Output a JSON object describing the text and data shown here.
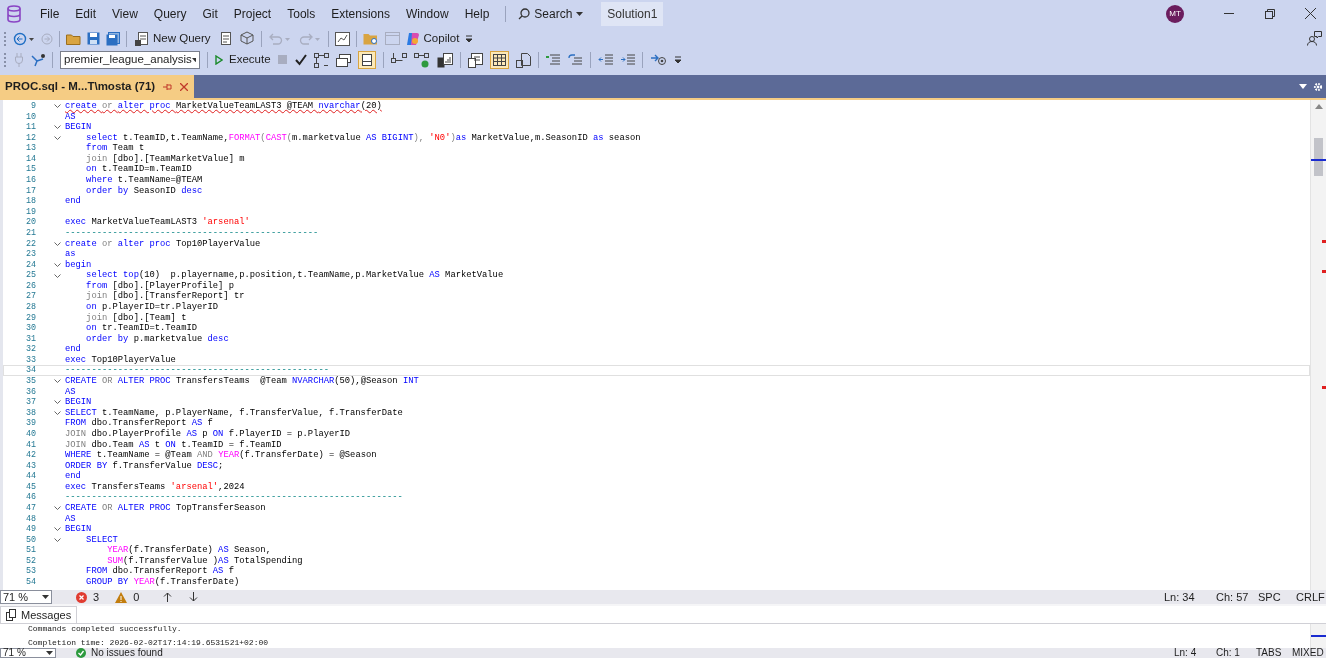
{
  "menu": [
    "File",
    "Edit",
    "View",
    "Query",
    "Git",
    "Project",
    "Tools",
    "Extensions",
    "Window",
    "Help"
  ],
  "search": {
    "label": "Search"
  },
  "solution": "Solution1",
  "avatar": "MT",
  "toolbar": {
    "new_query": "New Query",
    "copilot": "Copilot",
    "database": "premier_league_analysis",
    "execute": "Execute"
  },
  "tab": {
    "title": "PROC.sql - M...T\\mosta (71)",
    "selected": true
  },
  "editor": {
    "lines": [
      {
        "number": "9",
        "fold": true,
        "current": false,
        "error": true,
        "tokens": [
          {
            "kind": "kw",
            "text": "create "
          },
          {
            "kind": "op",
            "text": "or "
          },
          {
            "kind": "kw",
            "text": "alter proc "
          },
          {
            "kind": "id",
            "text": "MarketValueTeamLAST3 @TEAM "
          },
          {
            "kind": "kw",
            "text": "nvarchar"
          },
          {
            "kind": "id",
            "text": "(20)"
          }
        ]
      },
      {
        "number": "10",
        "fold": false,
        "current": false,
        "error": false,
        "tokens": [
          {
            "kind": "kw",
            "text": "AS"
          }
        ]
      },
      {
        "number": "11",
        "fold": true,
        "current": false,
        "error": false,
        "tokens": [
          {
            "kind": "kw",
            "text": "BEGIN"
          }
        ]
      },
      {
        "number": "12",
        "fold": true,
        "current": false,
        "error": false,
        "tokens": [
          {
            "kind": "kw",
            "text": "    select "
          },
          {
            "kind": "id",
            "text": "t.TeamID,t.TeamName,"
          },
          {
            "kind": "fn",
            "text": "FORMAT"
          },
          {
            "kind": "op",
            "text": "("
          },
          {
            "kind": "fn",
            "text": "CAST"
          },
          {
            "kind": "op",
            "text": "("
          },
          {
            "kind": "id",
            "text": "m.marketvalue "
          },
          {
            "kind": "kw",
            "text": "AS BIGINT"
          },
          {
            "kind": "op",
            "text": "), "
          },
          {
            "kind": "str",
            "text": "'N0'"
          },
          {
            "kind": "op",
            "text": ")"
          },
          {
            "kind": "kw",
            "text": "as "
          },
          {
            "kind": "id",
            "text": "MarketValue,m.SeasonID "
          },
          {
            "kind": "kw",
            "text": "as "
          },
          {
            "kind": "id",
            "text": "season"
          }
        ]
      },
      {
        "number": "13",
        "fold": false,
        "current": false,
        "error": false,
        "tokens": [
          {
            "kind": "kw",
            "text": "    from "
          },
          {
            "kind": "id",
            "text": "Team t"
          }
        ]
      },
      {
        "number": "14",
        "fold": false,
        "current": false,
        "error": false,
        "tokens": [
          {
            "kind": "op",
            "text": "    join "
          },
          {
            "kind": "id",
            "text": "[dbo].[TeamMarketValue] m"
          }
        ]
      },
      {
        "number": "15",
        "fold": false,
        "current": false,
        "error": false,
        "tokens": [
          {
            "kind": "kw",
            "text": "    on "
          },
          {
            "kind": "id",
            "text": "t.TeamID=m.TeamID"
          }
        ]
      },
      {
        "number": "16",
        "fold": false,
        "current": false,
        "error": false,
        "tokens": [
          {
            "kind": "kw",
            "text": "    where "
          },
          {
            "kind": "id",
            "text": "t.TeamName=@TEAM"
          }
        ]
      },
      {
        "number": "17",
        "fold": false,
        "current": false,
        "error": false,
        "tokens": [
          {
            "kind": "kw",
            "text": "    order by "
          },
          {
            "kind": "id",
            "text": "SeasonID "
          },
          {
            "kind": "kw",
            "text": "desc"
          }
        ]
      },
      {
        "number": "18",
        "fold": false,
        "current": false,
        "error": false,
        "tokens": [
          {
            "kind": "kw",
            "text": "end"
          }
        ]
      },
      {
        "number": "19",
        "fold": false,
        "current": false,
        "error": false
      },
      {
        "number": "20",
        "fold": false,
        "current": false,
        "error": false,
        "tokens": [
          {
            "kind": "kw",
            "text": "exec "
          },
          {
            "kind": "id",
            "text": "MarketValueTeamLAST3 "
          },
          {
            "kind": "str",
            "text": "'arsenal'"
          }
        ]
      },
      {
        "number": "21",
        "fold": false,
        "current": false,
        "error": false,
        "tokens": [
          {
            "kind": "cmt",
            "text": "------------------------------------------------"
          }
        ]
      },
      {
        "number": "22",
        "fold": true,
        "current": false,
        "error": false,
        "tokens": [
          {
            "kind": "kw",
            "text": "create "
          },
          {
            "kind": "op",
            "text": "or "
          },
          {
            "kind": "kw",
            "text": "alter proc "
          },
          {
            "kind": "id",
            "text": "Top10PlayerValue"
          }
        ]
      },
      {
        "number": "23",
        "fold": false,
        "current": false,
        "error": false,
        "tokens": [
          {
            "kind": "kw",
            "text": "as"
          }
        ]
      },
      {
        "number": "24",
        "fold": true,
        "current": false,
        "error": false,
        "tokens": [
          {
            "kind": "kw",
            "text": "begin"
          }
        ]
      },
      {
        "number": "25",
        "fold": true,
        "current": false,
        "error": false,
        "tokens": [
          {
            "kind": "kw",
            "text": "    select top"
          },
          {
            "kind": "id",
            "text": "(10)  p.playername,p.position,t.TeamName,p.MarketValue "
          },
          {
            "kind": "kw",
            "text": "AS "
          },
          {
            "kind": "id",
            "text": "MarketValue"
          }
        ]
      },
      {
        "number": "26",
        "fold": false,
        "current": false,
        "error": false,
        "tokens": [
          {
            "kind": "kw",
            "text": "    from "
          },
          {
            "kind": "id",
            "text": "[dbo].[PlayerProfile] p"
          }
        ]
      },
      {
        "number": "27",
        "fold": false,
        "current": false,
        "error": false,
        "tokens": [
          {
            "kind": "op",
            "text": "    join "
          },
          {
            "kind": "id",
            "text": "[dbo].[TransferReport] tr"
          }
        ]
      },
      {
        "number": "28",
        "fold": false,
        "current": false,
        "error": false,
        "tokens": [
          {
            "kind": "kw",
            "text": "    on "
          },
          {
            "kind": "id",
            "text": "p.PlayerID=tr.PlayerID"
          }
        ]
      },
      {
        "number": "29",
        "fold": false,
        "current": false,
        "error": false,
        "tokens": [
          {
            "kind": "op",
            "text": "    join "
          },
          {
            "kind": "id",
            "text": "[dbo].[Team] t"
          }
        ]
      },
      {
        "number": "30",
        "fold": false,
        "current": false,
        "error": false,
        "tokens": [
          {
            "kind": "kw",
            "text": "    on "
          },
          {
            "kind": "id",
            "text": "tr.TeamID=t.TeamID"
          }
        ]
      },
      {
        "number": "31",
        "fold": false,
        "current": false,
        "error": false,
        "tokens": [
          {
            "kind": "kw",
            "text": "    order by "
          },
          {
            "kind": "id",
            "text": "p.marketvalue "
          },
          {
            "kind": "kw",
            "text": "desc"
          }
        ]
      },
      {
        "number": "32",
        "fold": false,
        "current": false,
        "error": false,
        "tokens": [
          {
            "kind": "kw",
            "text": "end"
          }
        ]
      },
      {
        "number": "33",
        "fold": false,
        "current": false,
        "error": false,
        "tokens": [
          {
            "kind": "kw",
            "text": "exec "
          },
          {
            "kind": "id",
            "text": "Top10PlayerValue"
          }
        ]
      },
      {
        "number": "34",
        "fold": false,
        "current": true,
        "error": false,
        "tokens": [
          {
            "kind": "cmt",
            "text": "--------------------------------------------------"
          }
        ]
      },
      {
        "number": "35",
        "fold": true,
        "current": false,
        "error": false,
        "tokens": [
          {
            "kind": "kw",
            "text": "CREATE "
          },
          {
            "kind": "op",
            "text": "OR "
          },
          {
            "kind": "kw",
            "text": "ALTER PROC "
          },
          {
            "kind": "id",
            "text": "TransfersTeams  @Team "
          },
          {
            "kind": "kw",
            "text": "NVARCHAR"
          },
          {
            "kind": "id",
            "text": "(50),@Season "
          },
          {
            "kind": "kw",
            "text": "INT"
          }
        ]
      },
      {
        "number": "36",
        "fold": false,
        "current": false,
        "error": false,
        "tokens": [
          {
            "kind": "kw",
            "text": "AS"
          }
        ]
      },
      {
        "number": "37",
        "fold": true,
        "current": false,
        "error": false,
        "tokens": [
          {
            "kind": "kw",
            "text": "BEGIN"
          }
        ]
      },
      {
        "number": "38",
        "fold": true,
        "current": false,
        "error": false,
        "tokens": [
          {
            "kind": "kw",
            "text": "SELECT "
          },
          {
            "kind": "id",
            "text": "t.TeamName, p.PlayerName, f.TransferValue, f.TransferDate"
          }
        ]
      },
      {
        "number": "39",
        "fold": false,
        "current": false,
        "error": false,
        "tokens": [
          {
            "kind": "kw",
            "text": "FROM "
          },
          {
            "kind": "id",
            "text": "dbo.TransferReport "
          },
          {
            "kind": "kw",
            "text": "AS "
          },
          {
            "kind": "id",
            "text": "f"
          }
        ]
      },
      {
        "number": "40",
        "fold": false,
        "current": false,
        "error": false,
        "tokens": [
          {
            "kind": "op",
            "text": "JOIN "
          },
          {
            "kind": "id",
            "text": "dbo.PlayerProfile "
          },
          {
            "kind": "kw",
            "text": "AS "
          },
          {
            "kind": "id",
            "text": "p "
          },
          {
            "kind": "kw",
            "text": "ON "
          },
          {
            "kind": "id",
            "text": "f.PlayerID = p.PlayerID"
          }
        ]
      },
      {
        "number": "41",
        "fold": false,
        "current": false,
        "error": false,
        "tokens": [
          {
            "kind": "op",
            "text": "JOIN "
          },
          {
            "kind": "id",
            "text": "dbo.Team "
          },
          {
            "kind": "kw",
            "text": "AS "
          },
          {
            "kind": "id",
            "text": "t "
          },
          {
            "kind": "kw",
            "text": "ON "
          },
          {
            "kind": "id",
            "text": "t.TeamID = f.TeamID"
          }
        ]
      },
      {
        "number": "42",
        "fold": false,
        "current": false,
        "error": false,
        "tokens": [
          {
            "kind": "kw",
            "text": "WHERE "
          },
          {
            "kind": "id",
            "text": "t.TeamName = @Team "
          },
          {
            "kind": "op",
            "text": "AND "
          },
          {
            "kind": "fn",
            "text": "YEAR"
          },
          {
            "kind": "id",
            "text": "(f.TransferDate) = @Season"
          }
        ]
      },
      {
        "number": "43",
        "fold": false,
        "current": false,
        "error": false,
        "tokens": [
          {
            "kind": "kw",
            "text": "ORDER BY "
          },
          {
            "kind": "id",
            "text": "f.TransferValue "
          },
          {
            "kind": "kw",
            "text": "DESC"
          },
          {
            "kind": "id",
            "text": ";"
          }
        ]
      },
      {
        "number": "44",
        "fold": false,
        "current": false,
        "error": false,
        "tokens": [
          {
            "kind": "kw",
            "text": "end"
          }
        ]
      },
      {
        "number": "45",
        "fold": false,
        "current": false,
        "error": false,
        "tokens": [
          {
            "kind": "kw",
            "text": "exec "
          },
          {
            "kind": "id",
            "text": "TransfersTeams "
          },
          {
            "kind": "str",
            "text": "'arsenal'"
          },
          {
            "kind": "id",
            "text": ",2024"
          }
        ]
      },
      {
        "number": "46",
        "fold": false,
        "current": false,
        "error": false,
        "tokens": [
          {
            "kind": "cmt",
            "text": "----------------------------------------------------------------"
          }
        ]
      },
      {
        "number": "47",
        "fold": true,
        "current": false,
        "error": false,
        "tokens": [
          {
            "kind": "kw",
            "text": "CREATE "
          },
          {
            "kind": "op",
            "text": "OR "
          },
          {
            "kind": "kw",
            "text": "ALTER PROC "
          },
          {
            "kind": "id",
            "text": "TopTransferSeason"
          }
        ]
      },
      {
        "number": "48",
        "fold": false,
        "current": false,
        "error": false,
        "tokens": [
          {
            "kind": "kw",
            "text": "AS"
          }
        ]
      },
      {
        "number": "49",
        "fold": true,
        "current": false,
        "error": false,
        "tokens": [
          {
            "kind": "kw",
            "text": "BEGIN"
          }
        ]
      },
      {
        "number": "50",
        "fold": true,
        "current": false,
        "error": false,
        "tokens": [
          {
            "kind": "kw",
            "text": "    SELECT"
          }
        ]
      },
      {
        "number": "51",
        "fold": false,
        "current": false,
        "error": false,
        "tokens": [
          {
            "kind": "fn",
            "text": "        YEAR"
          },
          {
            "kind": "id",
            "text": "(f.TransferDate) "
          },
          {
            "kind": "kw",
            "text": "AS "
          },
          {
            "kind": "id",
            "text": "Season,"
          }
        ]
      },
      {
        "number": "52",
        "fold": false,
        "current": false,
        "error": false,
        "tokens": [
          {
            "kind": "fn",
            "text": "        SUM"
          },
          {
            "kind": "id",
            "text": "(f.TransferValue )"
          },
          {
            "kind": "kw",
            "text": "AS "
          },
          {
            "kind": "id",
            "text": "TotalSpending"
          }
        ]
      },
      {
        "number": "53",
        "fold": false,
        "current": false,
        "error": false,
        "tokens": [
          {
            "kind": "kw",
            "text": "    FROM "
          },
          {
            "kind": "id",
            "text": "dbo.TransferReport "
          },
          {
            "kind": "kw",
            "text": "AS "
          },
          {
            "kind": "id",
            "text": "f"
          }
        ]
      },
      {
        "number": "54",
        "fold": false,
        "current": false,
        "error": false,
        "tokens": [
          {
            "kind": "kw",
            "text": "    GROUP BY "
          },
          {
            "kind": "fn",
            "text": "YEAR"
          },
          {
            "kind": "id",
            "text": "(f.TransferDate)"
          }
        ]
      }
    ]
  },
  "editor_status": {
    "zoom": "71 %",
    "errors": "3",
    "warnings": "0",
    "ln": "Ln: 34",
    "ch": "Ch: 57",
    "spacing": "SPC",
    "eol": "CRLF"
  },
  "messages": {
    "tab": "Messages",
    "lines": [
      "Commands completed successfully.",
      "Completion time: 2026-02-02T17:14:19.6531521+02:00"
    ]
  },
  "results_status": {
    "zoom": "71 %",
    "issues": "No issues found",
    "ln": "Ln: 4",
    "ch": "Ch: 1",
    "spacing": "TABS",
    "eol": "MIXED"
  }
}
